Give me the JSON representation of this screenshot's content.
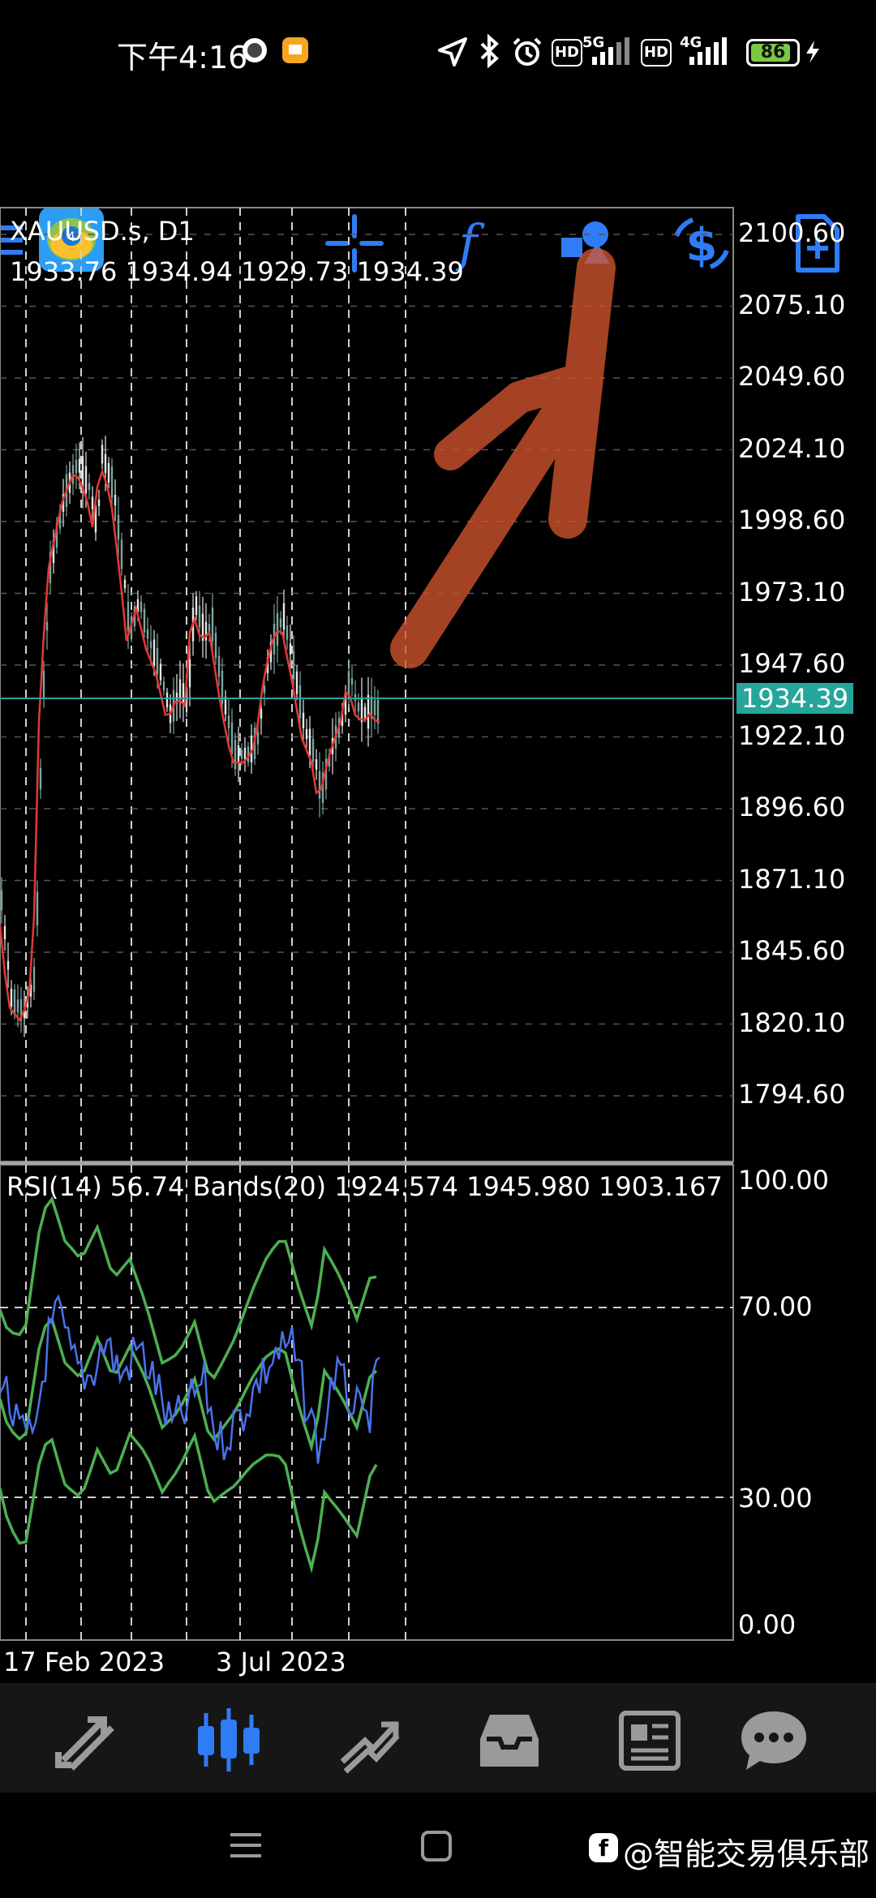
{
  "status_bar": {
    "time": "下午4:16",
    "net_5g": "5G",
    "net_4g": "4G",
    "hd1": "HD",
    "hd2": "HD",
    "battery": "86",
    "battery_color": "#7ac943"
  },
  "toolbar": {
    "menu_icon": "hamburger-menu-icon",
    "app_icon": "metatrader-logo-icon",
    "items": [
      "crosshair-icon",
      "indicators-f-icon",
      "objects-shapes-icon",
      "symbol-dollar-icon",
      "new-order-document-icon"
    ],
    "accent": "#2f7cf6"
  },
  "chart": {
    "symbol": "XAUUSD.s, D1",
    "ohlc": "1933.76 1934.94 1929.73 1934.39",
    "current_price": "1934.39",
    "current_price_color": "#26a69a",
    "price_axis": [
      "2100.60",
      "2075.10",
      "2049.60",
      "2024.10",
      "1998.60",
      "1973.10",
      "1947.60",
      "1922.10",
      "1896.60",
      "1871.10",
      "1845.60",
      "1820.10",
      "1794.60"
    ],
    "rsi_header": "RSI(14) 56.74 Bands(20) 1924.574 1945.980 1903.167",
    "rsi_axis": [
      "100.00",
      "70.00",
      "30.00",
      "0.00"
    ],
    "dates": [
      "17 Feb 2023",
      "3 Jul 2023"
    ],
    "price_line_color": "#e53935",
    "rsi_color": "#4a72e8",
    "bands_color": "#4caf50",
    "annotation": "orange-arrow-drawing",
    "annotation_color": "#d2552e"
  },
  "bottom_nav": {
    "items": [
      "quotes-arrows-icon",
      "chart-candles-icon",
      "trade-lines-icon",
      "history-inbox-icon",
      "news-icon",
      "chat-icon"
    ],
    "active_index": 1
  },
  "watermark": "@智能交易俱乐部",
  "gesture_bar": [
    "menu-lines-icon",
    "home-square-icon"
  ]
}
